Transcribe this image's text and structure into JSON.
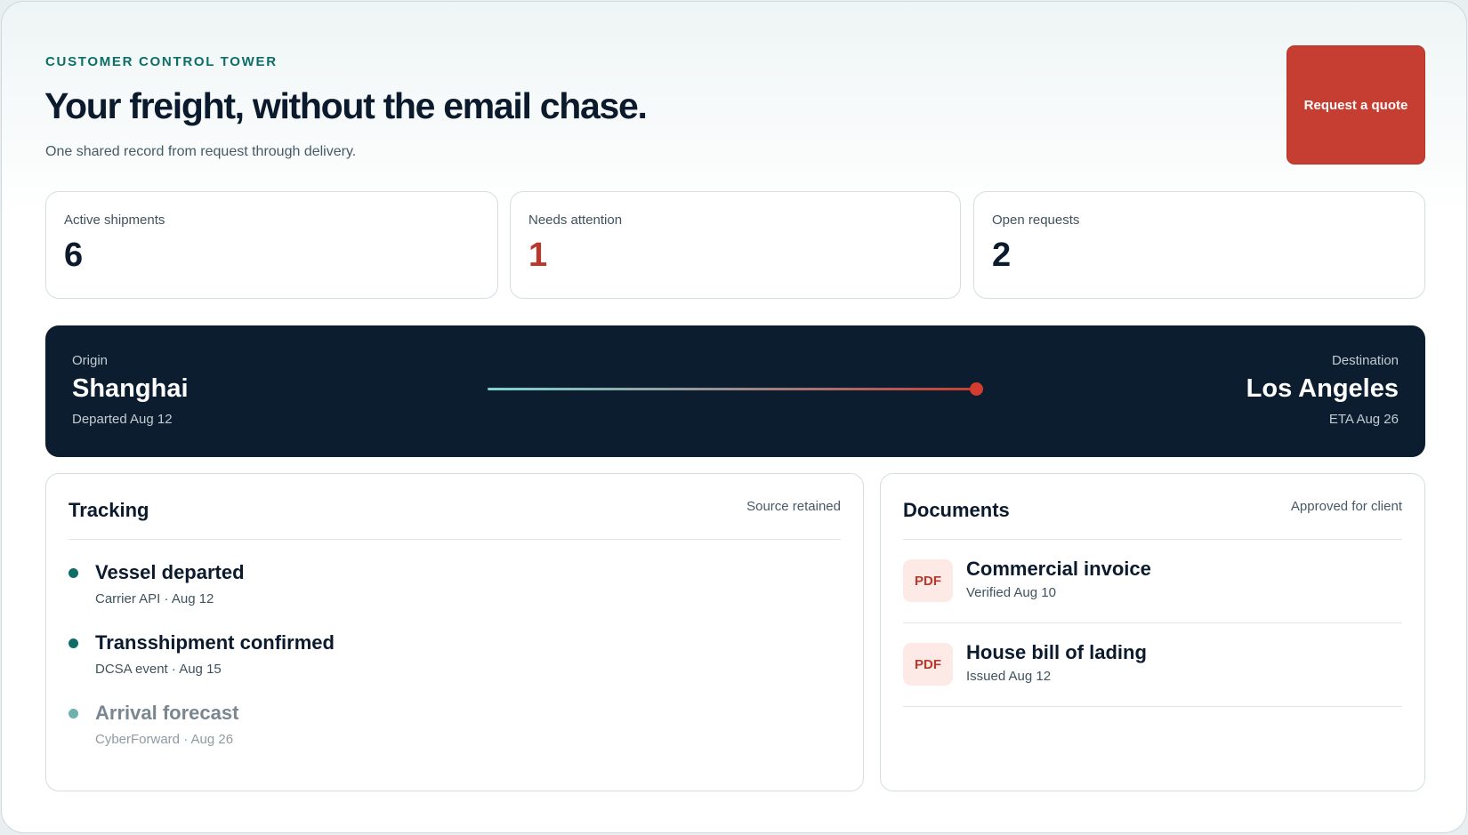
{
  "header": {
    "kicker": "CUSTOMER CONTROL TOWER",
    "headline": "Your freight, without the email chase.",
    "subhead": "One shared record from request through delivery.",
    "cta_label": "Request a quote"
  },
  "stats": [
    {
      "label": "Active shipments",
      "value": "6",
      "status": "normal"
    },
    {
      "label": "Needs attention",
      "value": "1",
      "status": "alert"
    },
    {
      "label": "Open requests",
      "value": "2",
      "status": "normal"
    }
  ],
  "route": {
    "origin_label": "Origin",
    "origin_city": "Shanghai",
    "origin_sub": "Departed Aug 12",
    "destination_label": "Destination",
    "destination_city": "Los Angeles",
    "destination_sub": "ETA Aug 26"
  },
  "tracking": {
    "title": "Tracking",
    "meta": "Source retained",
    "events": [
      {
        "title": "Vessel departed",
        "sub": "Carrier API · Aug 12",
        "state": "done"
      },
      {
        "title": "Transshipment confirmed",
        "sub": "DCSA event · Aug 15",
        "state": "done"
      },
      {
        "title": "Arrival forecast",
        "sub": "CyberForward · Aug 26",
        "state": "pending"
      }
    ]
  },
  "documents": {
    "title": "Documents",
    "meta": "Approved for client",
    "items": [
      {
        "badge": "PDF",
        "title": "Commercial invoice",
        "sub": "Verified Aug 10"
      },
      {
        "badge": "PDF",
        "title": "House bill of lading",
        "sub": "Issued Aug 12"
      }
    ]
  },
  "colors": {
    "accent_teal": "#0f6d68",
    "alert_red": "#c63e31",
    "navy": "#0b1d2f"
  }
}
